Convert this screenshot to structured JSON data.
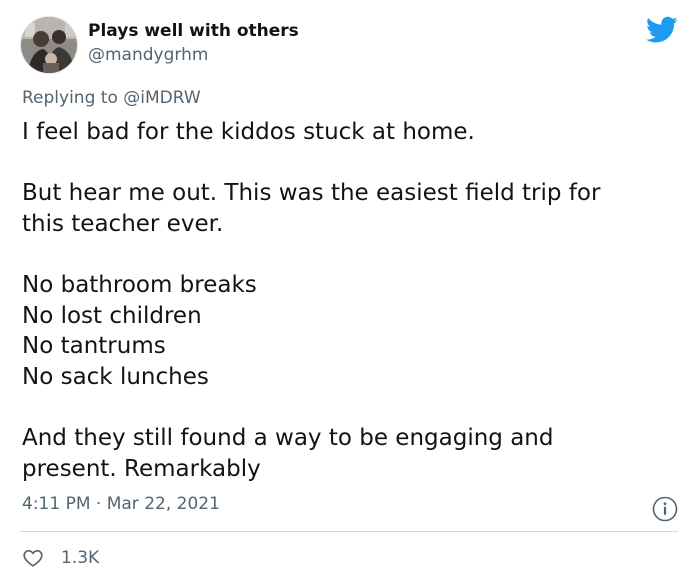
{
  "user": {
    "display_name": "Plays well with others",
    "handle": "@mandygrhm"
  },
  "reply": {
    "prefix": "Replying to ",
    "mention": "@iMDRW"
  },
  "tweet": {
    "paragraphs": [
      [
        "I feel bad for the kiddos stuck at home."
      ],
      [
        "But hear me out. This was the easiest field trip for",
        "this teacher ever."
      ],
      [
        "No bathroom breaks",
        "No lost children",
        "No tantrums",
        "No sack lunches"
      ],
      [
        "And they still found a way to be engaging and",
        "present. Remarkably"
      ]
    ]
  },
  "meta": {
    "timestamp": "4:11 PM · Mar 22, 2021",
    "likes": "1.3K"
  },
  "colors": {
    "brand": "#1d9bf0",
    "text": "#0f1419",
    "muted": "#536471"
  },
  "icons": {
    "logo": "twitter-bird-icon",
    "info": "info-icon",
    "like": "heart-outline-icon"
  }
}
